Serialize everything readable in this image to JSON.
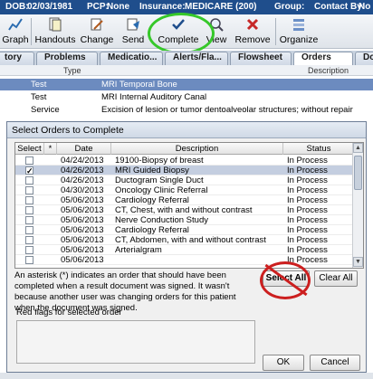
{
  "patient_bar": {
    "dob_label": "DOB:",
    "dob": "02/03/1981",
    "pcp_label": "PCP:",
    "pcp": "None",
    "insurance_label": "Insurance:",
    "insurance": "MEDICARE (200)",
    "group_label": "Group:",
    "contact_label": "Contact By:",
    "contact": "No L"
  },
  "toolbar": {
    "graph": "Graph",
    "handouts": "Handouts",
    "change": "Change",
    "send": "Send",
    "complete": "Complete",
    "view": "View",
    "remove": "Remove",
    "organize": "Organize"
  },
  "tabs": [
    "tory",
    "Problems",
    "Medicatio...",
    "Alerts/Fla...",
    "Flowsheet",
    "Orders",
    "Doc"
  ],
  "background_list": {
    "col_type": "Type",
    "col_description": "Description",
    "rows": [
      {
        "type": "Test",
        "description": "MRI Temporal Bone"
      },
      {
        "type": "Test",
        "description": "MRI Internal Auditory Canal"
      },
      {
        "type": "Service",
        "description": "Excision of lesion or tumor dentoalveolar structures; without repair"
      }
    ]
  },
  "dialog": {
    "title": "Select Orders to Complete",
    "columns": {
      "select": "Select",
      "asterisk": "*",
      "date": "Date",
      "description": "Description",
      "status": "Status"
    },
    "rows": [
      {
        "checked": "",
        "date": "04/24/2013",
        "description": "19100-Biopsy of breast",
        "status": "In Process"
      },
      {
        "checked": "✓",
        "date": "04/26/2013",
        "description": "MRI Guided Biopsy",
        "status": "In Process"
      },
      {
        "checked": "",
        "date": "04/26/2013",
        "description": "Ductogram Single Duct",
        "status": "In Process"
      },
      {
        "checked": "",
        "date": "04/30/2013",
        "description": "Oncology Clinic Referral",
        "status": "In Process"
      },
      {
        "checked": "",
        "date": "05/06/2013",
        "description": "Cardiology Referral",
        "status": "In Process"
      },
      {
        "checked": "",
        "date": "05/06/2013",
        "description": "CT, Chest, with and without contrast",
        "status": "In Process"
      },
      {
        "checked": "",
        "date": "05/06/2013",
        "description": "Nerve Conduction Study",
        "status": "In Process"
      },
      {
        "checked": "",
        "date": "05/06/2013",
        "description": "Cardiology Referral",
        "status": "In Process"
      },
      {
        "checked": "",
        "date": "05/06/2013",
        "description": "CT, Abdomen, with and without contrast",
        "status": "In Process"
      },
      {
        "checked": "",
        "date": "05/06/2013",
        "description": "Arterialgram",
        "status": "In Process"
      },
      {
        "checked": "",
        "date": "05/06/2013",
        "description": "",
        "status": "In Process"
      }
    ],
    "note": "An asterisk (*) indicates an order that should have been completed when a result document was signed. It wasn't because another user was changing orders for this patient when the document was signed.",
    "select_all": "Select All",
    "clear_all": "Clear All",
    "red_flags_label": "Red flags for selected order",
    "ok": "OK",
    "cancel": "Cancel"
  },
  "colors": {
    "patient_bar": "#1f4e8c",
    "highlight_circle": "#36c82a",
    "strike_circle": "#cc1f1f",
    "selected_row": "#c4cee0"
  }
}
